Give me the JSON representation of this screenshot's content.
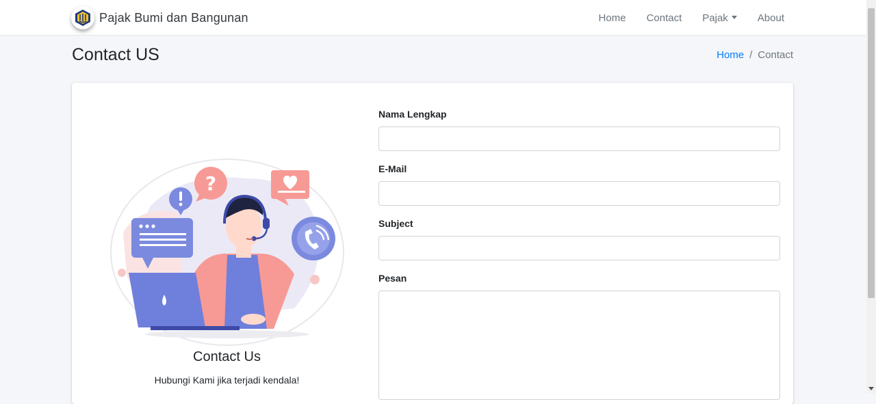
{
  "brand": {
    "title": "Pajak Bumi dan Bangunan",
    "logo_icon": "kemenkeu-emblem-icon"
  },
  "nav": {
    "items": [
      {
        "label": "Home"
      },
      {
        "label": "Contact"
      },
      {
        "label": "Pajak",
        "dropdown": true
      },
      {
        "label": "About"
      }
    ]
  },
  "page": {
    "title": "Contact US"
  },
  "breadcrumb": {
    "home": "Home",
    "separator": "/",
    "current": "Contact"
  },
  "contact_info": {
    "heading": "Contact Us",
    "subtext": "Hubungi Kami jika terjadi kendala!",
    "illustration": "customer-support-illustration"
  },
  "form": {
    "fields": [
      {
        "label": "Nama Lengkap",
        "value": "",
        "placeholder": ""
      },
      {
        "label": "E-Mail",
        "value": "",
        "placeholder": ""
      },
      {
        "label": "Subject",
        "value": "",
        "placeholder": ""
      },
      {
        "label": "Pesan",
        "value": "",
        "placeholder": ""
      }
    ]
  },
  "colors": {
    "link": "#007bff",
    "nav_text": "#6c757d",
    "background": "#f4f6f9",
    "illustration_blue": "#6f7fdc",
    "illustration_pink": "#f79a95"
  }
}
